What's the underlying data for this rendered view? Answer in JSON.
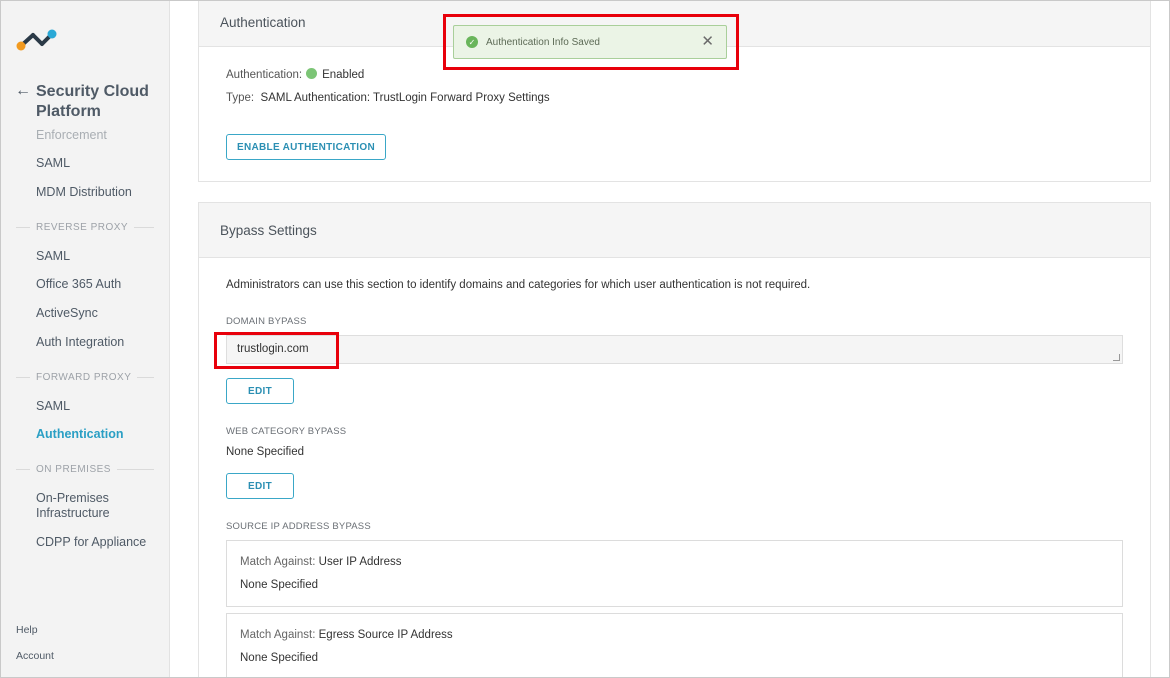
{
  "sidebar": {
    "platform_title": "Security Cloud Platform",
    "items": [
      {
        "label": "Enforcement"
      },
      {
        "label": "SAML"
      },
      {
        "label": "MDM Distribution"
      },
      {
        "label": "REVERSE PROXY"
      },
      {
        "label": "SAML"
      },
      {
        "label": "Office 365 Auth"
      },
      {
        "label": "ActiveSync"
      },
      {
        "label": "Auth Integration"
      },
      {
        "label": "FORWARD PROXY"
      },
      {
        "label": "SAML"
      },
      {
        "label": "Authentication"
      },
      {
        "label": "ON PREMISES"
      },
      {
        "label": "On-Premises Infrastructure"
      },
      {
        "label": "CDPP for Appliance"
      }
    ],
    "footer": {
      "help": "Help",
      "account": "Account"
    }
  },
  "toast": {
    "message": "Authentication Info Saved"
  },
  "authentication": {
    "title": "Authentication",
    "status_label": "Authentication:",
    "status_value": "Enabled",
    "type_label": "Type:",
    "type_value": "SAML Authentication: TrustLogin Forward Proxy Settings",
    "enable_button": "ENABLE AUTHENTICATION",
    "status_color": "#7cc576"
  },
  "bypass": {
    "title": "Bypass Settings",
    "description": "Administrators can use this section to identify domains and categories for which user authentication is not required.",
    "domain_label": "DOMAIN BYPASS",
    "domain_value": "trustlogin.com",
    "edit_label": "EDIT",
    "web_category_label": "WEB CATEGORY BYPASS",
    "web_category_value": "None Specified",
    "source_ip_label": "SOURCE IP ADDRESS BYPASS",
    "match_prefix": "Match Against:",
    "user_ip_match": "User IP Address",
    "user_ip_value": "None Specified",
    "egress_match": "Egress Source IP Address",
    "egress_value": "None Specified"
  },
  "colors": {
    "accent": "#2a9fc4",
    "highlight": "#e8000b"
  }
}
